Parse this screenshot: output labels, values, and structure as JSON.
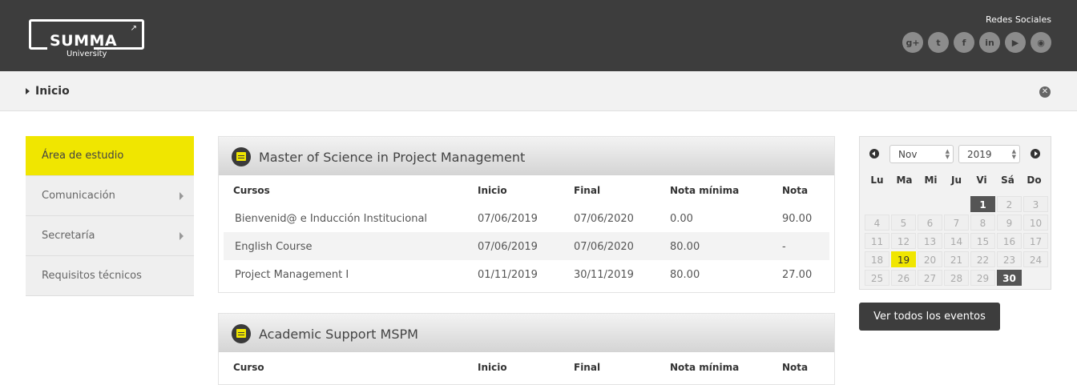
{
  "header": {
    "logo_main": "SUMMA",
    "logo_sub": "University",
    "logo_arrow": "↗",
    "social_label": "Redes Sociales",
    "social_icons": [
      {
        "name": "google-plus-icon",
        "glyph": "g+"
      },
      {
        "name": "twitter-icon",
        "glyph": "t"
      },
      {
        "name": "facebook-icon",
        "glyph": "f"
      },
      {
        "name": "linkedin-icon",
        "glyph": "in"
      },
      {
        "name": "youtube-icon",
        "glyph": "▶"
      },
      {
        "name": "globe-icon",
        "glyph": "◉"
      }
    ]
  },
  "breadcrumb": {
    "label": "Inicio",
    "close_glyph": "✕"
  },
  "sidebar": {
    "items": [
      {
        "label": "Área de estudio"
      },
      {
        "label": "Comunicación"
      },
      {
        "label": "Secretaría"
      },
      {
        "label": "Requisitos técnicos"
      }
    ]
  },
  "panels": [
    {
      "title": "Master of Science in Project Management",
      "headers": [
        "Cursos",
        "Inicio",
        "Final",
        "Nota mínima",
        "Nota"
      ],
      "rows": [
        [
          "Bienvenid@ e Inducción Institucional",
          "07/06/2019",
          "07/06/2020",
          "0.00",
          "90.00"
        ],
        [
          "English Course",
          "07/06/2019",
          "07/06/2020",
          "80.00",
          "-"
        ],
        [
          "Project Management I",
          "01/11/2019",
          "30/11/2019",
          "80.00",
          "27.00"
        ]
      ]
    },
    {
      "title": "Academic Support MSPM",
      "headers": [
        "Curso",
        "Inicio",
        "Final",
        "Nota mínima",
        "Nota"
      ],
      "rows": []
    }
  ],
  "calendar": {
    "month": "Nov",
    "year": "2019",
    "weekdays": [
      "Lu",
      "Ma",
      "Mi",
      "Ju",
      "Vi",
      "Sá",
      "Do"
    ],
    "days": [
      "1",
      "2",
      "3",
      "4",
      "5",
      "6",
      "7",
      "8",
      "9",
      "10",
      "11",
      "12",
      "13",
      "14",
      "15",
      "16",
      "17",
      "18",
      "19",
      "20",
      "21",
      "22",
      "23",
      "24",
      "25",
      "26",
      "27",
      "28",
      "29",
      "30"
    ],
    "highlight_today": "19"
  },
  "events_button": "Ver todos los eventos",
  "colors": {
    "accent": "#f0e600",
    "header_bg": "#3d3d3d"
  }
}
